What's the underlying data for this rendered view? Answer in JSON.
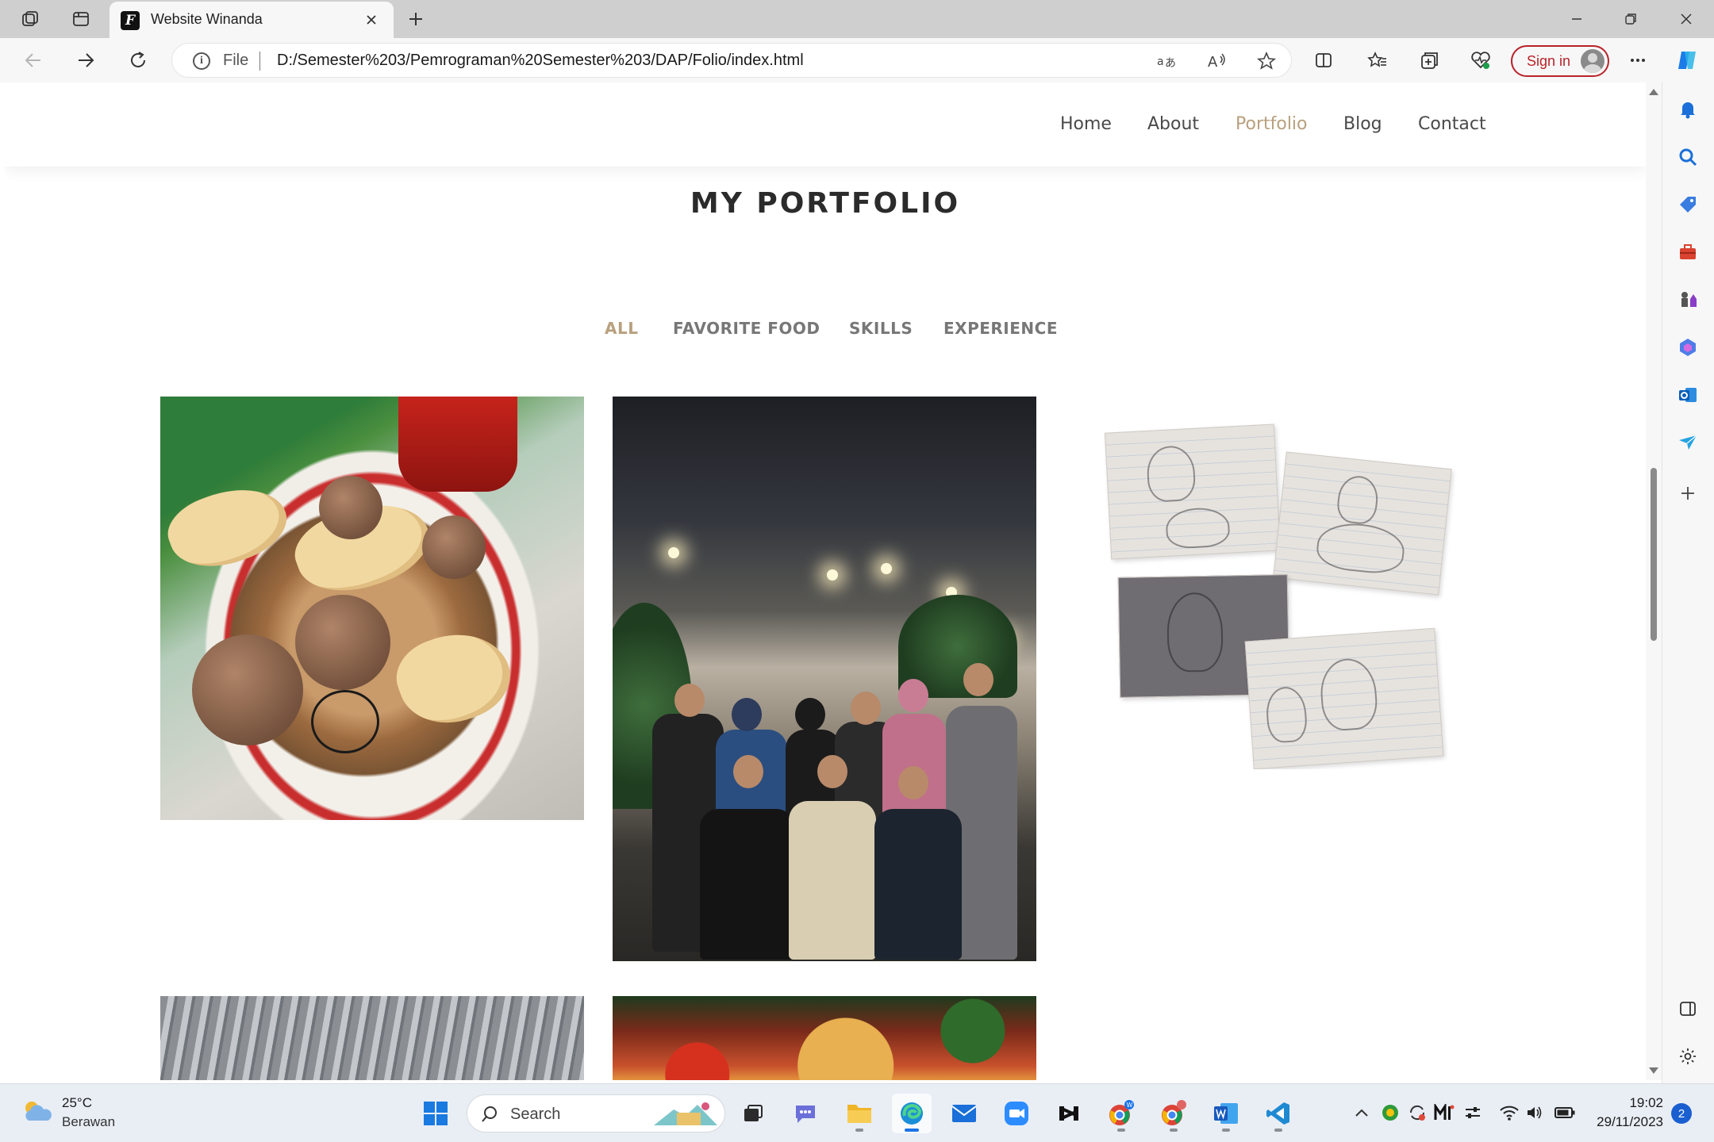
{
  "browser": {
    "tab": {
      "title": "Website Winanda",
      "favicon_letter": "F"
    },
    "address": {
      "scheme_label": "File",
      "url": "D:/Semester%203/Pemrograman%20Semester%203/DAP/Folio/index.html"
    },
    "account": {
      "signin_label": "Sign in"
    }
  },
  "site": {
    "nav": [
      {
        "label": "Home",
        "active": false
      },
      {
        "label": "About",
        "active": false
      },
      {
        "label": "Portfolio",
        "active": true
      },
      {
        "label": "Blog",
        "active": false
      },
      {
        "label": "Contact",
        "active": false
      }
    ],
    "section_title": "MY PORTFOLIO",
    "filters": [
      {
        "label": "ALL",
        "active": true
      },
      {
        "label": "FAVORITE FOOD",
        "active": false
      },
      {
        "label": "SKILLS",
        "active": false
      },
      {
        "label": "EXPERIENCE",
        "active": false
      }
    ],
    "accent_color": "#b8a07e"
  },
  "taskbar": {
    "weather": {
      "temp": "25°C",
      "desc": "Berawan"
    },
    "search_label": "Search",
    "clock": {
      "time": "19:02",
      "date": "29/11/2023"
    },
    "notifications": "2"
  }
}
